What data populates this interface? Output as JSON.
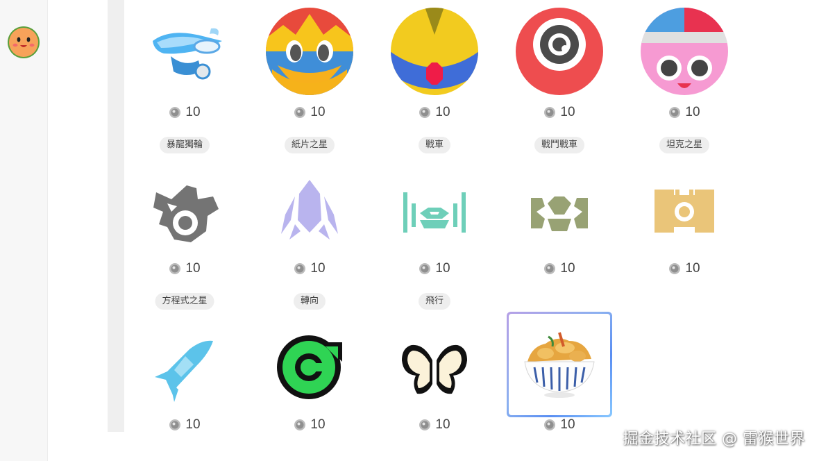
{
  "rewards": [
    {
      "name_tag": "",
      "price": "10",
      "icon": "robo-wheelie-icon"
    },
    {
      "name_tag": "",
      "price": "10",
      "icon": "king-dedede-face-icon"
    },
    {
      "name_tag": "",
      "price": "10",
      "icon": "yellow-crown-emblem-icon"
    },
    {
      "name_tag": "",
      "price": "10",
      "icon": "red-eye-face-icon"
    },
    {
      "name_tag": "",
      "price": "10",
      "icon": "pink-blue-face-icon"
    },
    {
      "name_tag": "暴龍獨輪",
      "price": "10",
      "icon": "dragon-wheel-icon"
    },
    {
      "name_tag": "紙片之星",
      "price": "10",
      "icon": "paper-star-icon"
    },
    {
      "name_tag": "戰車",
      "price": "10",
      "icon": "tank-icon"
    },
    {
      "name_tag": "戰鬥戰車",
      "price": "10",
      "icon": "battle-tank-icon"
    },
    {
      "name_tag": "坦克之星",
      "price": "10",
      "icon": "tank-star-icon"
    },
    {
      "name_tag": "方程式之星",
      "price": "10",
      "icon": "formula-star-icon"
    },
    {
      "name_tag": "轉向",
      "price": "10",
      "icon": "turn-arrow-icon"
    },
    {
      "name_tag": "飛行",
      "price": "10",
      "icon": "wings-icon"
    },
    {
      "name_tag": "",
      "price": "10",
      "icon": "tempura-bowl-image"
    }
  ],
  "watermark": "掘金技术社区 @ 雷猴世界",
  "colors": {
    "tag_bg": "#eeeeee",
    "price_text": "#444444",
    "selected_gradient_start": "#b6a0e6",
    "selected_gradient_end": "#5a8ef2"
  }
}
